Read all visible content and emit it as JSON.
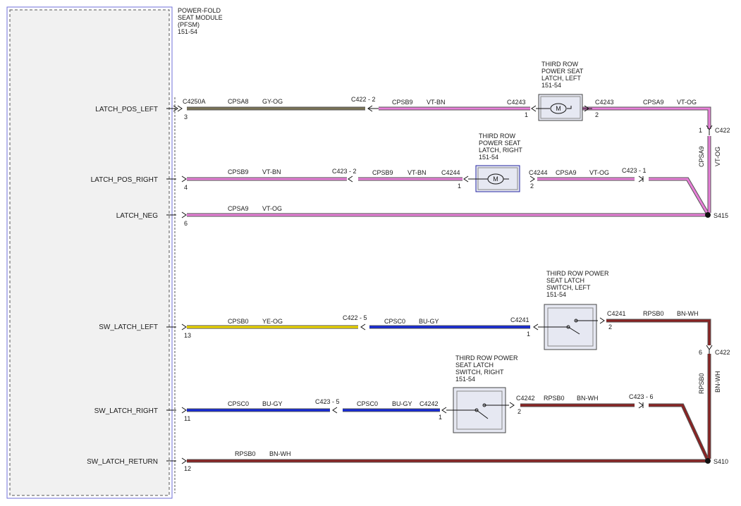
{
  "module": {
    "title_lines": [
      "POWER-FOLD",
      "SEAT MODULE",
      "(PFSM)",
      "151-54"
    ],
    "connector": "C4250A"
  },
  "module_pins": [
    {
      "name": "LATCH_POS_LEFT",
      "pin": "3"
    },
    {
      "name": "LATCH_POS_RIGHT",
      "pin": "4"
    },
    {
      "name": "LATCH_NEG",
      "pin": "6"
    },
    {
      "name": "SW_LATCH_LEFT",
      "pin": "13"
    },
    {
      "name": "SW_LATCH_RIGHT",
      "pin": "11"
    },
    {
      "name": "SW_LATCH_RETURN",
      "pin": "12"
    }
  ],
  "wires": {
    "w1": {
      "circuit": "CPSA8",
      "color": "GY-OG"
    },
    "w2": {
      "circuit": "CPSB9",
      "color": "VT-BN"
    },
    "w3": {
      "circuit": "CPSA9",
      "color": "VT-OG"
    },
    "w4": {
      "circuit": "CPSB9",
      "color": "VT-BN"
    },
    "w5": {
      "circuit": "CPSB9",
      "color": "VT-BN"
    },
    "w6": {
      "circuit": "CPSA9",
      "color": "VT-OG"
    },
    "w7": {
      "circuit": "CPSA9",
      "color": "VT-OG"
    },
    "w8": {
      "circuit": "CPSB0",
      "color": "YE-OG"
    },
    "w9": {
      "circuit": "CPSC0",
      "color": "BU-GY"
    },
    "w10": {
      "circuit": "RPSB0",
      "color": "BN-WH"
    },
    "w11": {
      "circuit": "CPSC0",
      "color": "BU-GY"
    },
    "w12": {
      "circuit": "CPSC0",
      "color": "BU-GY"
    },
    "w13": {
      "circuit": "RPSB0",
      "color": "BN-WH"
    },
    "w14": {
      "circuit": "RPSB0",
      "color": "BN-WH"
    },
    "v1": {
      "circuit": "CPSA9",
      "color": "VT-OG"
    },
    "v2": {
      "circuit": "RPSB0",
      "color": "BN-WH"
    }
  },
  "connectors": {
    "c422_2": "C422 - 2",
    "c4243_in": "C4243",
    "c4243_in_pin": "1",
    "c4243_out": "C4243",
    "c4243_out_pin": "2",
    "c422_1": "C422",
    "c422_1_pin": "1",
    "c423_2": "C423 - 2",
    "c4244_in": "C4244",
    "c4244_in_pin": "1",
    "c4244_out": "C4244",
    "c4244_out_pin": "2",
    "c423_1": "C423 - 1",
    "c422_5": "C422 - 5",
    "c4241_in": "C4241",
    "c4241_in_pin": "1",
    "c4241_out": "C4241",
    "c4241_out_pin": "2",
    "c422_6": "C422",
    "c422_6_pin": "6",
    "c423_5": "C423 - 5",
    "c4242_in": "C4242",
    "c4242_in_pin": "1",
    "c4242_out": "C4242",
    "c4242_out_pin": "2",
    "c423_6": "C423 - 6"
  },
  "splices": {
    "s415": "S415",
    "s410": "S410"
  },
  "components": {
    "latch_left": [
      "THIRD ROW",
      "POWER SEAT",
      "LATCH, LEFT",
      "151-54"
    ],
    "latch_right": [
      "THIRD ROW",
      "POWER SEAT",
      "LATCH, RIGHT",
      "151-54"
    ],
    "switch_left": [
      "THIRD ROW POWER",
      "SEAT LATCH",
      "SWITCH, LEFT",
      "151-54"
    ],
    "switch_right": [
      "THIRD ROW POWER",
      "SEAT LATCH",
      "SWITCH, RIGHT",
      "151-54"
    ],
    "motor_symbol": "M"
  },
  "colors": {
    "violet": "#e87fd8",
    "grey_orange": "#7a7356",
    "yellow": "#f0d800",
    "blue": "#1428d8",
    "brown": "#8a2323"
  }
}
